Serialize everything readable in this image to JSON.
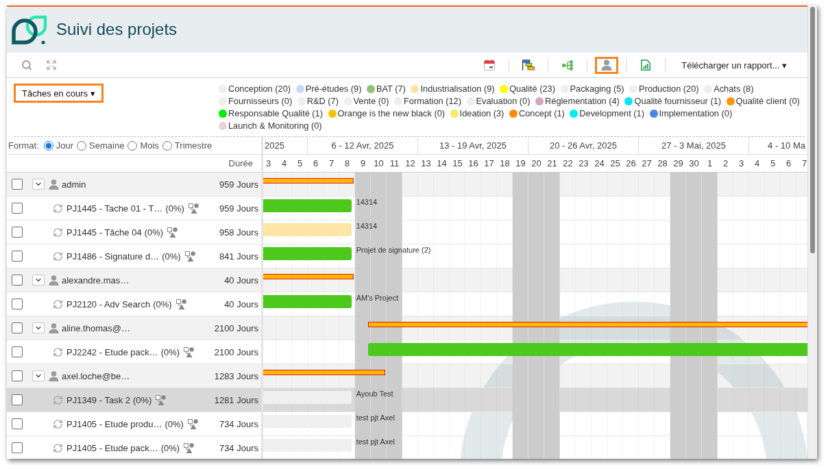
{
  "header": {
    "title": "Suivi des projets"
  },
  "toolbar": {
    "buttons": [
      {
        "kind": "calendar",
        "selected": false
      },
      {
        "kind": "gantt",
        "selected": false
      },
      {
        "kind": "tree",
        "selected": false
      },
      {
        "kind": "person",
        "selected": true
      },
      {
        "kind": "report",
        "selected": false
      }
    ],
    "report_menu": "Télécharger un rapport... ▾"
  },
  "filter": {
    "label": "Tâches en cours ▾",
    "highlighted": true,
    "legend": [
      {
        "label": "Conception (20)",
        "color": "#eeeeee"
      },
      {
        "label": "Pré-études (9)",
        "color": "#c9daf8"
      },
      {
        "label": "BAT (7)",
        "color": "#8fc27c"
      },
      {
        "label": "Industrialisation (9)",
        "color": "#ffe3a1"
      },
      {
        "label": "Qualité (23)",
        "color": "#ffff00"
      },
      {
        "label": "Packaging (5)",
        "color": "#eeeeee"
      },
      {
        "label": "Production (20)",
        "color": "#eeeeee"
      },
      {
        "label": "Achats (8)",
        "color": "#eeeeee"
      },
      {
        "label": "Fournisseurs (0)",
        "color": "#eeeeee"
      },
      {
        "label": "R&D (7)",
        "color": "#eeeeee"
      },
      {
        "label": "Vente (0)",
        "color": "#eeeeee"
      },
      {
        "label": "Formation (12)",
        "color": "#eeeeee"
      },
      {
        "label": "Evaluation (0)",
        "color": "#eeeeee"
      },
      {
        "label": "Réglementation (4)",
        "color": "#d5a6bd"
      },
      {
        "label": "Qualité fournisseur (1)",
        "color": "#00e8f8"
      },
      {
        "label": "Qualité client (0)",
        "color": "#ff9400"
      },
      {
        "label": "Responsable Qualité (1)",
        "color": "#00ee00"
      },
      {
        "label": "Orange is the new black (0)",
        "color": "#ffc000"
      },
      {
        "label": "Ideation (3)",
        "color": "#f5e96f"
      },
      {
        "label": "Concept (1)",
        "color": "#ff8c00"
      },
      {
        "label": "Development (1)",
        "color": "#00f0f0"
      },
      {
        "label": "Implementation (0)",
        "color": "#4a86e8"
      },
      {
        "label": "Launch & Monitoring (0)",
        "color": "#ead1dc"
      }
    ]
  },
  "format": {
    "label": "Format:",
    "options": [
      {
        "label": "Jour",
        "selected": true
      },
      {
        "label": "Semaine",
        "selected": false
      },
      {
        "label": "Mois",
        "selected": false
      },
      {
        "label": "Trimestre",
        "selected": false
      }
    ]
  },
  "table": {
    "columns": [
      "Durée"
    ],
    "groups": [
      {
        "name": "admin",
        "duration": "959 Jours",
        "expanded": true,
        "checked": false,
        "selected": false,
        "bar": {
          "level": 0.166
        },
        "children": [
          {
            "name": "PJ1445 - Tache 01 - T…",
            "progress": "(0%)",
            "duration": "959 Jours",
            "checked": false,
            "selected": false,
            "bar": {
              "color": "#4cc91c",
              "continues_left": true,
              "level": 0.162,
              "label": "14314"
            }
          },
          {
            "name": "PJ1445 - Tâche 04",
            "progress": "(0%)",
            "duration": "958 Jours",
            "checked": false,
            "selected": false,
            "bar": {
              "color": "#ffe5a6",
              "continues_left": true,
              "level": 0.162,
              "label": "14314"
            }
          },
          {
            "name": "PJ1486 - Signature d…",
            "progress": "(0%)",
            "duration": "841 Jours",
            "checked": false,
            "selected": false,
            "bar": {
              "color": "#4cc91c",
              "continues_left": true,
              "level": 0.162,
              "label": "Projet de signature (2)"
            }
          }
        ]
      },
      {
        "name": "alexandre.mas…",
        "duration": "40 Jours",
        "expanded": true,
        "checked": false,
        "selected": false,
        "bar": {
          "level": 0.166
        },
        "children": [
          {
            "name": "PJ2120 - Adv Search",
            "progress": "(0%)",
            "duration": "40 Jours",
            "checked": false,
            "selected": false,
            "bar": {
              "color": "#4cc91c",
              "continues_left": true,
              "level": 0.162,
              "label": "AM's Project"
            }
          }
        ]
      },
      {
        "name": "aline.thomas@…",
        "duration": "2100 Jours",
        "expanded": true,
        "checked": false,
        "selected": false,
        "bar": {
          "level": 0.807
        },
        "children": [
          {
            "name": "PJ2242 - Etude pack…",
            "progress": "(0%)",
            "duration": "2100 Jours",
            "checked": false,
            "selected": false,
            "bar": {
              "color": "#4cc91c",
              "continues_left": false,
              "level": 0.807
            }
          }
        ]
      },
      {
        "name": "axel.loche@be…",
        "duration": "1283 Jours",
        "expanded": true,
        "checked": false,
        "selected": false,
        "bar": {
          "level": 0.224
        },
        "children": [
          {
            "name": "PJ1349 - Task 2",
            "progress": "(0%)",
            "duration": "1281 Jours",
            "checked": false,
            "selected": true,
            "bar": {
              "color": "#f0f0f0",
              "continues_left": true,
              "level": 0.162,
              "label": "Ayoub Test"
            }
          },
          {
            "name": "PJ1405 - Etude produ…",
            "progress": "(0%)",
            "duration": "734 Jours",
            "checked": false,
            "selected": false,
            "bar": {
              "color": "#f0f0f0",
              "continues_left": true,
              "level": 0.162,
              "label": "test pjt Axel"
            }
          },
          {
            "name": "PJ1405 - Etude pack…",
            "progress": "(0%)",
            "duration": "734 Jours",
            "checked": false,
            "selected": false,
            "bar": {
              "color": "#f0f0f0",
              "continues_left": true,
              "level": 0.162,
              "label": "test pjt Axel"
            }
          }
        ]
      }
    ]
  },
  "timeline": {
    "weeks": [
      {
        "label": "2025",
        "days": [
          {
            "label": "3",
            "shaded": false
          },
          {
            "label": "4",
            "shaded": false
          },
          {
            "label": "5",
            "shaded": false
          }
        ]
      },
      {
        "label": "6 - 12 Avr, 2025",
        "days": [
          {
            "label": "6",
            "shaded": false
          },
          {
            "label": "7",
            "shaded": false
          },
          {
            "label": "8",
            "shaded": false
          },
          {
            "label": "9",
            "shaded": true
          },
          {
            "label": "10",
            "shaded": true
          },
          {
            "label": "11",
            "shaded": true
          },
          {
            "label": "12",
            "shaded": false
          }
        ]
      },
      {
        "label": "13 - 19 Avr, 2025",
        "days": [
          {
            "label": "13",
            "shaded": false
          },
          {
            "label": "14",
            "shaded": false
          },
          {
            "label": "15",
            "shaded": false
          },
          {
            "label": "16",
            "shaded": false
          },
          {
            "label": "17",
            "shaded": false
          },
          {
            "label": "18",
            "shaded": false
          },
          {
            "label": "19",
            "shaded": true
          }
        ]
      },
      {
        "label": "20 - 26 Avr, 2025",
        "days": [
          {
            "label": "20",
            "shaded": true
          },
          {
            "label": "21",
            "shaded": true
          },
          {
            "label": "22",
            "shaded": false
          },
          {
            "label": "23",
            "shaded": false
          },
          {
            "label": "24",
            "shaded": false
          },
          {
            "label": "25",
            "shaded": false
          },
          {
            "label": "26",
            "shaded": false
          }
        ]
      },
      {
        "label": "27 - 3 Mai, 2025",
        "days": [
          {
            "label": "27",
            "shaded": false
          },
          {
            "label": "28",
            "shaded": false
          },
          {
            "label": "29",
            "shaded": true
          },
          {
            "label": "30",
            "shaded": true
          },
          {
            "label": "1",
            "shaded": true
          },
          {
            "label": "2",
            "shaded": false
          },
          {
            "label": "3",
            "shaded": false
          }
        ]
      },
      {
        "label": "4 - 10 Ma",
        "days": [
          {
            "label": "4",
            "shaded": false
          },
          {
            "label": "5",
            "shaded": false
          },
          {
            "label": "6",
            "shaded": false
          },
          {
            "label": "7",
            "shaded": false
          }
        ]
      }
    ]
  }
}
